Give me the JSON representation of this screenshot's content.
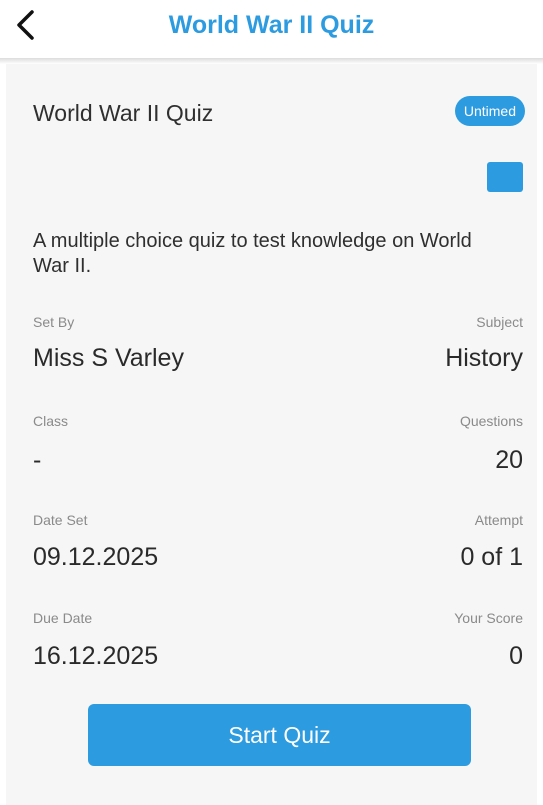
{
  "header": {
    "title": "World War II Quiz",
    "back_icon": "back-arrow-icon"
  },
  "quiz": {
    "title": "World War II Quiz",
    "badge": "Untimed",
    "color": "#2d9be0",
    "description": "A multiple choice quiz to test knowledge on World War II."
  },
  "fields": {
    "set_by": {
      "label": "Set By",
      "value": "Miss S Varley"
    },
    "subject": {
      "label": "Subject",
      "value": "History"
    },
    "class": {
      "label": "Class",
      "value": "-"
    },
    "questions": {
      "label": "Questions",
      "value": "20"
    },
    "date_set": {
      "label": "Date Set",
      "value": "09.12.2025"
    },
    "attempt": {
      "label": "Attempt",
      "value": "0 of 1"
    },
    "due_date": {
      "label": "Due Date",
      "value": "16.12.2025"
    },
    "your_score": {
      "label": "Your Score",
      "value": "0"
    }
  },
  "actions": {
    "start_label": "Start Quiz"
  },
  "colors": {
    "accent": "#2d9be0",
    "card_background": "#f6f6f6"
  }
}
